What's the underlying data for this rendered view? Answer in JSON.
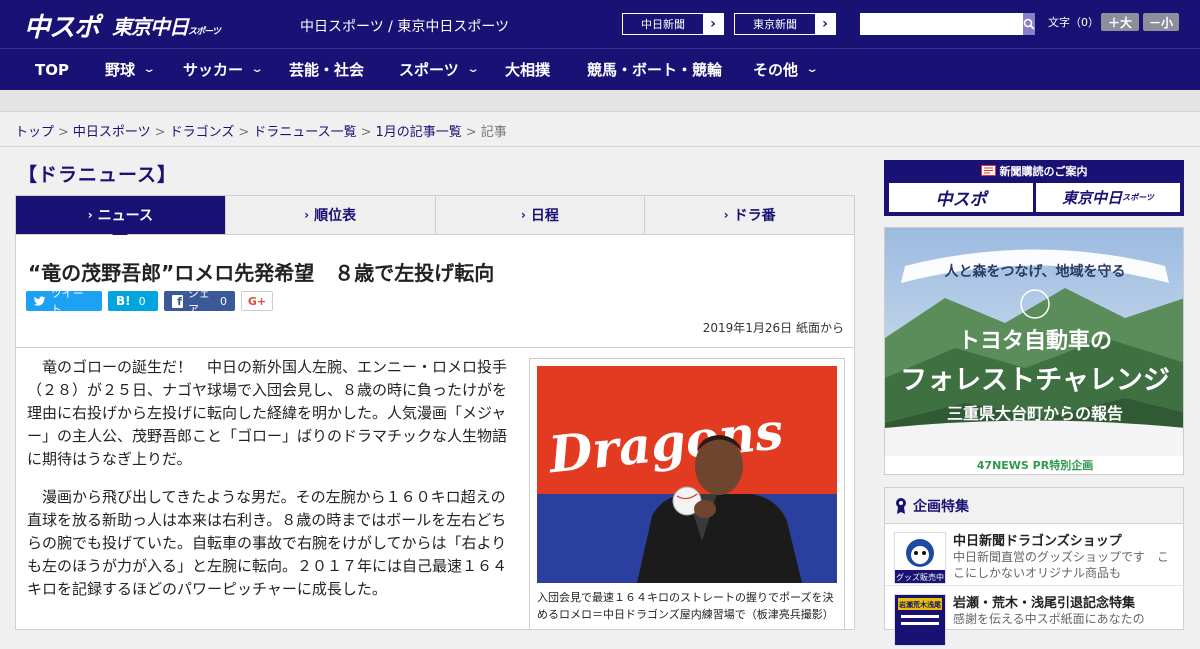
{
  "header": {
    "logo_primary": "中スポ",
    "logo_secondary": "東京中日",
    "logo_secondary_small": "スポーツ",
    "site_name": "中日スポーツ / 東京中日スポーツ",
    "links": [
      "中日新聞",
      "東京新聞"
    ],
    "search_placeholder": "",
    "font_size_label": "文字（0）",
    "font_larger": "＋大",
    "font_smaller": "－小"
  },
  "nav": {
    "items": [
      {
        "label": "TOP"
      },
      {
        "label": "野球",
        "dropdown": true
      },
      {
        "label": "サッカー",
        "dropdown": true
      },
      {
        "label": "芸能・社会"
      },
      {
        "label": "スポーツ",
        "dropdown": true
      },
      {
        "label": "大相撲"
      },
      {
        "label": "競馬・ボート・競輪"
      },
      {
        "label": "その他",
        "dropdown": true
      }
    ]
  },
  "breadcrumb": {
    "items": [
      "トップ",
      "中日スポーツ",
      "ドラゴンズ",
      "ドラニュース一覧",
      "1月の記事一覧"
    ],
    "current": "記事",
    "separator": ">"
  },
  "section": {
    "title": "【ドラニュース】"
  },
  "tabs": [
    {
      "label": "ニュース",
      "active": true
    },
    {
      "label": "順位表"
    },
    {
      "label": "日程"
    },
    {
      "label": "ドラ番"
    }
  ],
  "article": {
    "headline": "“竜の茂野吾郎”ロメロ先発希望　８歳で左投げ転向",
    "share": {
      "tweet": "ツイート",
      "hatena": "B!",
      "hatena_count": "0",
      "facebook": "シェア",
      "facebook_count": "0",
      "gplus": "G+"
    },
    "date": "2019年1月26日 紙面から",
    "paragraphs": [
      "竜のゴローの誕生だ！　中日の新外国人左腕、エンニー・ロメロ投手（２８）が２５日、ナゴヤ球場で入団会見し、８歳の時に負ったけがを理由に右投げから左投げに転向した経緯を明かした。人気漫画「メジャー」の主人公、茂野吾郎こと「ゴロー」ばりのドラマチックな人生物語に期待はうなぎ上りだ。",
      "漫画から飛び出してきたような男だ。その左腕から１６０キロ超えの直球を放る新助っ人は本来は右利き。８歳の時まではボールを左右どちらの腕でも投げていた。自転車の事故で右腕をけがしてからは「右よりも左のほうが力が入る」と左腕に転向。２０１７年には自己最速１６４キロを記録するほどのパワーピッチャーに成長した。"
    ],
    "photo_brand": "Dragons",
    "photo_caption": "入団会見で最速１６４キロのストレートの握りでポーズを決めるロメロ＝中日ドラゴンズ屋内練習場で（板津亮兵撮影）"
  },
  "sidebar": {
    "subscribe_title": "新聞購読のご案内",
    "subscribe_logos": [
      "中スポ",
      "東京中日"
    ],
    "subscribe_logo_small": "スポーツ",
    "ad": {
      "line1": "人と森をつなげ、地域を守る",
      "line2": "トヨタ自動車の",
      "line3": "フォレストチャレンジ",
      "line4": "三重県大台町からの報告",
      "footer": "47NEWS PR特別企画"
    },
    "special": {
      "title": "企画特集",
      "items": [
        {
          "title": "中日新聞ドラゴンズショップ",
          "desc": "中日新聞直営のグッズショップです　ここにしかないオリジナル商品も",
          "thumb_text": "グッズ販売中"
        },
        {
          "title": "岩瀬・荒木・浅尾引退記念特集",
          "desc": "感謝を伝える中スポ紙面にあなたの",
          "thumb_text": "岩瀬荒木浅尾"
        }
      ]
    }
  }
}
